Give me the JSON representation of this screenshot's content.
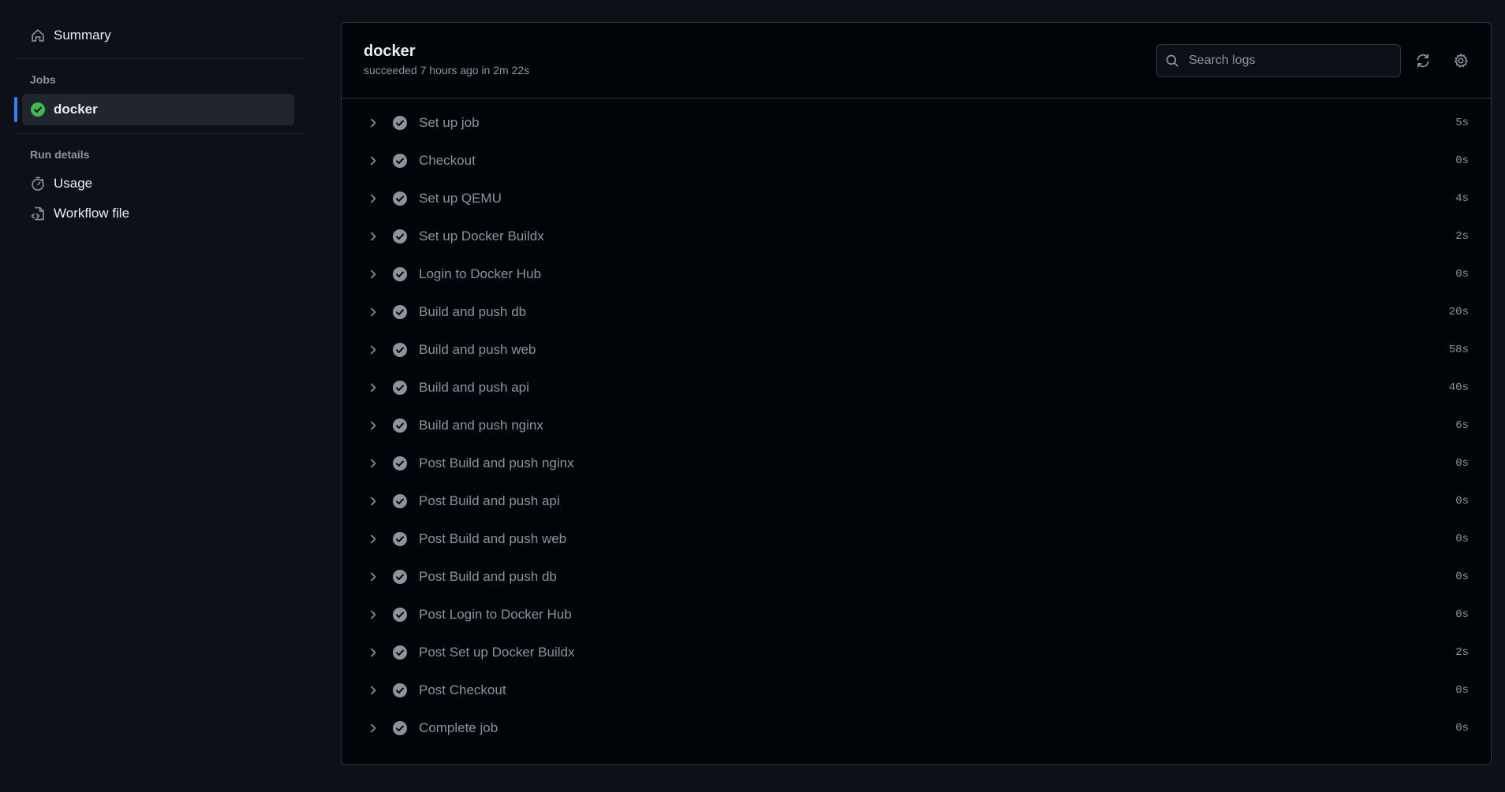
{
  "sidebar": {
    "summary_label": "Summary",
    "jobs_title": "Jobs",
    "job": {
      "name": "docker",
      "status": "success"
    },
    "run_details_title": "Run details",
    "usage_label": "Usage",
    "workflow_file_label": "Workflow file"
  },
  "header": {
    "title": "docker",
    "subtitle": "succeeded 7 hours ago in 2m 22s",
    "search_placeholder": "Search logs"
  },
  "steps": [
    {
      "name": "Set up job",
      "duration": "5s"
    },
    {
      "name": "Checkout",
      "duration": "0s"
    },
    {
      "name": "Set up QEMU",
      "duration": "4s"
    },
    {
      "name": "Set up Docker Buildx",
      "duration": "2s"
    },
    {
      "name": "Login to Docker Hub",
      "duration": "0s"
    },
    {
      "name": "Build and push db",
      "duration": "20s"
    },
    {
      "name": "Build and push web",
      "duration": "58s"
    },
    {
      "name": "Build and push api",
      "duration": "40s"
    },
    {
      "name": "Build and push nginx",
      "duration": "6s"
    },
    {
      "name": "Post Build and push nginx",
      "duration": "0s"
    },
    {
      "name": "Post Build and push api",
      "duration": "0s"
    },
    {
      "name": "Post Build and push web",
      "duration": "0s"
    },
    {
      "name": "Post Build and push db",
      "duration": "0s"
    },
    {
      "name": "Post Login to Docker Hub",
      "duration": "0s"
    },
    {
      "name": "Post Set up Docker Buildx",
      "duration": "2s"
    },
    {
      "name": "Post Checkout",
      "duration": "0s"
    },
    {
      "name": "Complete job",
      "duration": "0s"
    }
  ],
  "colors": {
    "background": "#0d1117",
    "panel": "#010409",
    "accent": "#2f81f7",
    "success": "#3fb950",
    "step_check": "#8b949e"
  },
  "icons": {
    "summary": "home-icon",
    "job_status": "check-circle-fill-icon",
    "usage": "stopwatch-icon",
    "workflow_file": "file-code-icon",
    "search": "search-icon",
    "refresh": "sync-icon",
    "settings": "gear-icon",
    "step_expand": "chevron-right-icon",
    "step_status": "check-circle-fill-icon"
  }
}
